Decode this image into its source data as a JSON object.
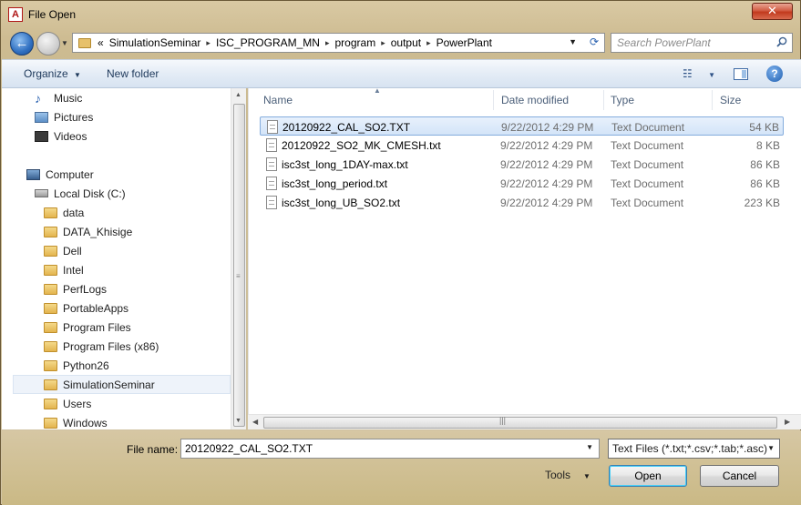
{
  "window": {
    "title": "File Open",
    "app_icon_letter": "A",
    "close_glyph": "✕"
  },
  "address_bar": {
    "overflow": "«",
    "crumbs": [
      "SimulationSeminar",
      "ISC_PROGRAM_MN",
      "program",
      "output",
      "PowerPlant"
    ]
  },
  "search": {
    "placeholder": "Search PowerPlant"
  },
  "toolbar": {
    "organize": "Organize",
    "new_folder": "New folder",
    "help": "?"
  },
  "nav": {
    "items": [
      "Music",
      "Pictures",
      "Videos",
      "Computer",
      "Local Disk (C:)",
      "data",
      "DATA_Khisige",
      "Dell",
      "Intel",
      "PerfLogs",
      "PortableApps",
      "Program Files",
      "Program Files (x86)",
      "Python26",
      "SimulationSeminar",
      "Users",
      "Windows"
    ],
    "selected": "SimulationSeminar"
  },
  "columns": {
    "name": "Name",
    "date": "Date modified",
    "type": "Type",
    "size": "Size"
  },
  "files": [
    {
      "name": "20120922_CAL_SO2.TXT",
      "date": "9/22/2012 4:29 PM",
      "type": "Text Document",
      "size": "54 KB"
    },
    {
      "name": "20120922_SO2_MK_CMESH.txt",
      "date": "9/22/2012 4:29 PM",
      "type": "Text Document",
      "size": "8 KB"
    },
    {
      "name": "isc3st_long_1DAY-max.txt",
      "date": "9/22/2012 4:29 PM",
      "type": "Text Document",
      "size": "86 KB"
    },
    {
      "name": "isc3st_long_period.txt",
      "date": "9/22/2012 4:29 PM",
      "type": "Text Document",
      "size": "86 KB"
    },
    {
      "name": "isc3st_long_UB_SO2.txt",
      "date": "9/22/2012 4:29 PM",
      "type": "Text Document",
      "size": "223 KB"
    }
  ],
  "footer": {
    "file_name_label": "File name:",
    "file_name_value": "20120922_CAL_SO2.TXT",
    "filter": "Text Files (*.txt;*.csv;*.tab;*.asc)",
    "tools": "Tools",
    "open": "Open",
    "cancel": "Cancel"
  }
}
